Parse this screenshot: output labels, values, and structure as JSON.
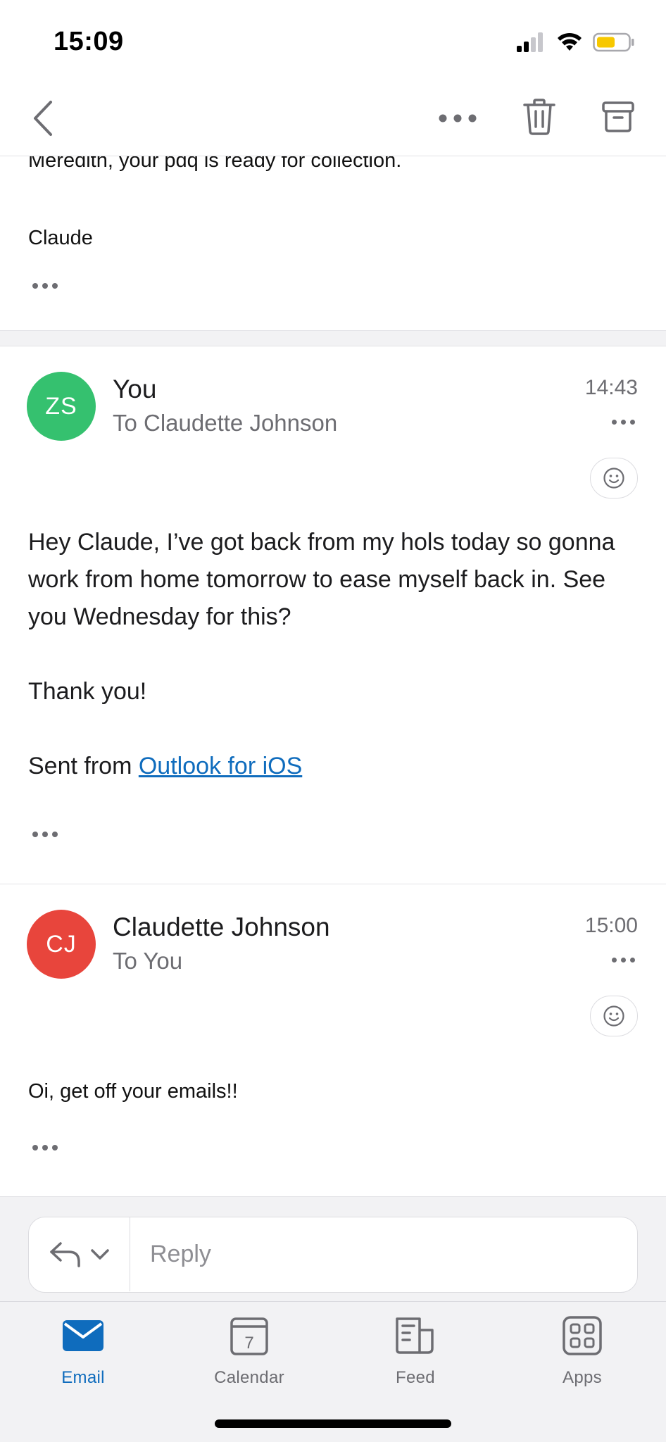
{
  "status_bar": {
    "time": "15:09"
  },
  "nav": {
    "back_icon": "chevron-left-icon",
    "more_icon": "more-horizontal-icon",
    "trash_icon": "trash-icon",
    "archive_icon": "archive-icon"
  },
  "previous_message": {
    "line1": "Meredith, your pdq is ready for collection.",
    "signature": "Claude"
  },
  "messages": [
    {
      "initials": "ZS",
      "avatar_color": "#35c16f",
      "sender": "You",
      "recipient": "To Claudette Johnson",
      "time": "14:43",
      "body_paragraph1": "Hey Claude, I’ve got back from my hols today so gonna work from home tomorrow to ease myself back in. See you Wednesday for this?",
      "body_paragraph2": "Thank you!",
      "sent_from_prefix": "Sent from ",
      "sent_from_link": "Outlook for iOS"
    },
    {
      "initials": "CJ",
      "avatar_color": "#e8453c",
      "sender": "Claudette Johnson",
      "recipient": "To You",
      "time": "15:00",
      "body": "Oi, get off your emails!!"
    }
  ],
  "reply": {
    "placeholder": "Reply"
  },
  "tabs": [
    {
      "label": "Email",
      "icon": "mail-icon",
      "active": true
    },
    {
      "label": "Calendar",
      "icon": "calendar-icon",
      "day": "7"
    },
    {
      "label": "Feed",
      "icon": "feed-icon"
    },
    {
      "label": "Apps",
      "icon": "apps-grid-icon"
    }
  ],
  "colors": {
    "accent": "#0f6cbd",
    "battery": "#f7c800"
  }
}
